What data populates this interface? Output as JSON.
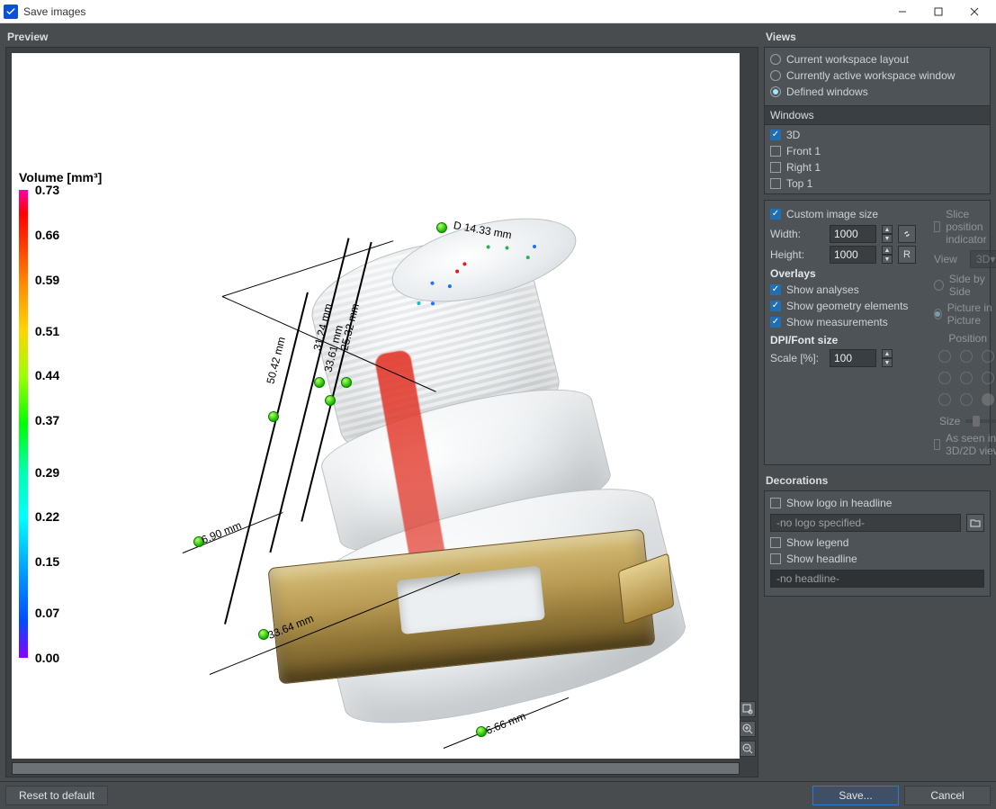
{
  "window": {
    "title": "Save images"
  },
  "preview": {
    "header": "Preview"
  },
  "legend": {
    "title": "Volume [mm³]",
    "ticks": [
      {
        "v": "0.73",
        "pct": 0
      },
      {
        "v": "0.66",
        "pct": 9.7
      },
      {
        "v": "0.59",
        "pct": 19.2
      },
      {
        "v": "0.51",
        "pct": 30.1
      },
      {
        "v": "0.44",
        "pct": 39.7
      },
      {
        "v": "0.37",
        "pct": 49.3
      },
      {
        "v": "0.29",
        "pct": 60.3
      },
      {
        "v": "0.22",
        "pct": 69.9
      },
      {
        "v": "0.15",
        "pct": 79.5
      },
      {
        "v": "0.07",
        "pct": 90.4
      },
      {
        "v": "0.00",
        "pct": 100
      }
    ]
  },
  "dimensions": {
    "d1": "D 14.33 mm",
    "h1": "31.24 mm",
    "h2": "25.32 mm",
    "h3": "50.42 mm",
    "h4": "33.61 mm",
    "s1": "6.90 mm",
    "b1": "33.64 mm",
    "b2": "6.66 mm"
  },
  "views": {
    "header": "Views",
    "opt1": "Current workspace layout",
    "opt2": "Currently active workspace window",
    "opt3": "Defined windows",
    "listHead": "Windows",
    "items": [
      {
        "label": "3D",
        "checked": true
      },
      {
        "label": "Front 1",
        "checked": false
      },
      {
        "label": "Right 1",
        "checked": false
      },
      {
        "label": "Top 1",
        "checked": false
      }
    ]
  },
  "image": {
    "customLabel": "Custom image size",
    "widthLabel": "Width:",
    "heightLabel": "Height:",
    "width": "1000",
    "height": "1000",
    "linkTip": "link-icon",
    "resetTip": "R"
  },
  "slice": {
    "indicatorLabel": "Slice position indicator",
    "viewLabel": "View",
    "viewValue": "3D",
    "sideBySide": "Side by Side",
    "pip": "Picture in Picture",
    "positionLabel": "Position",
    "sizeLabel": "Size",
    "asSeenLabel": "As seen in 3D/2D view"
  },
  "overlays": {
    "header": "Overlays",
    "showAnalyses": "Show analyses",
    "showGeom": "Show geometry elements",
    "showMeas": "Show measurements"
  },
  "dpi": {
    "header": "DPI/Font size",
    "scaleLabel": "Scale [%]:",
    "scale": "100"
  },
  "decor": {
    "header": "Decorations",
    "logoLabel": "Show logo in headline",
    "logoPlaceholder": "-no logo specified-",
    "legendLabel": "Show legend",
    "headlineLabel": "Show headline",
    "headlinePlaceholder": "-no headline-"
  },
  "footer": {
    "reset": "Reset to default",
    "save": "Save...",
    "cancel": "Cancel"
  }
}
